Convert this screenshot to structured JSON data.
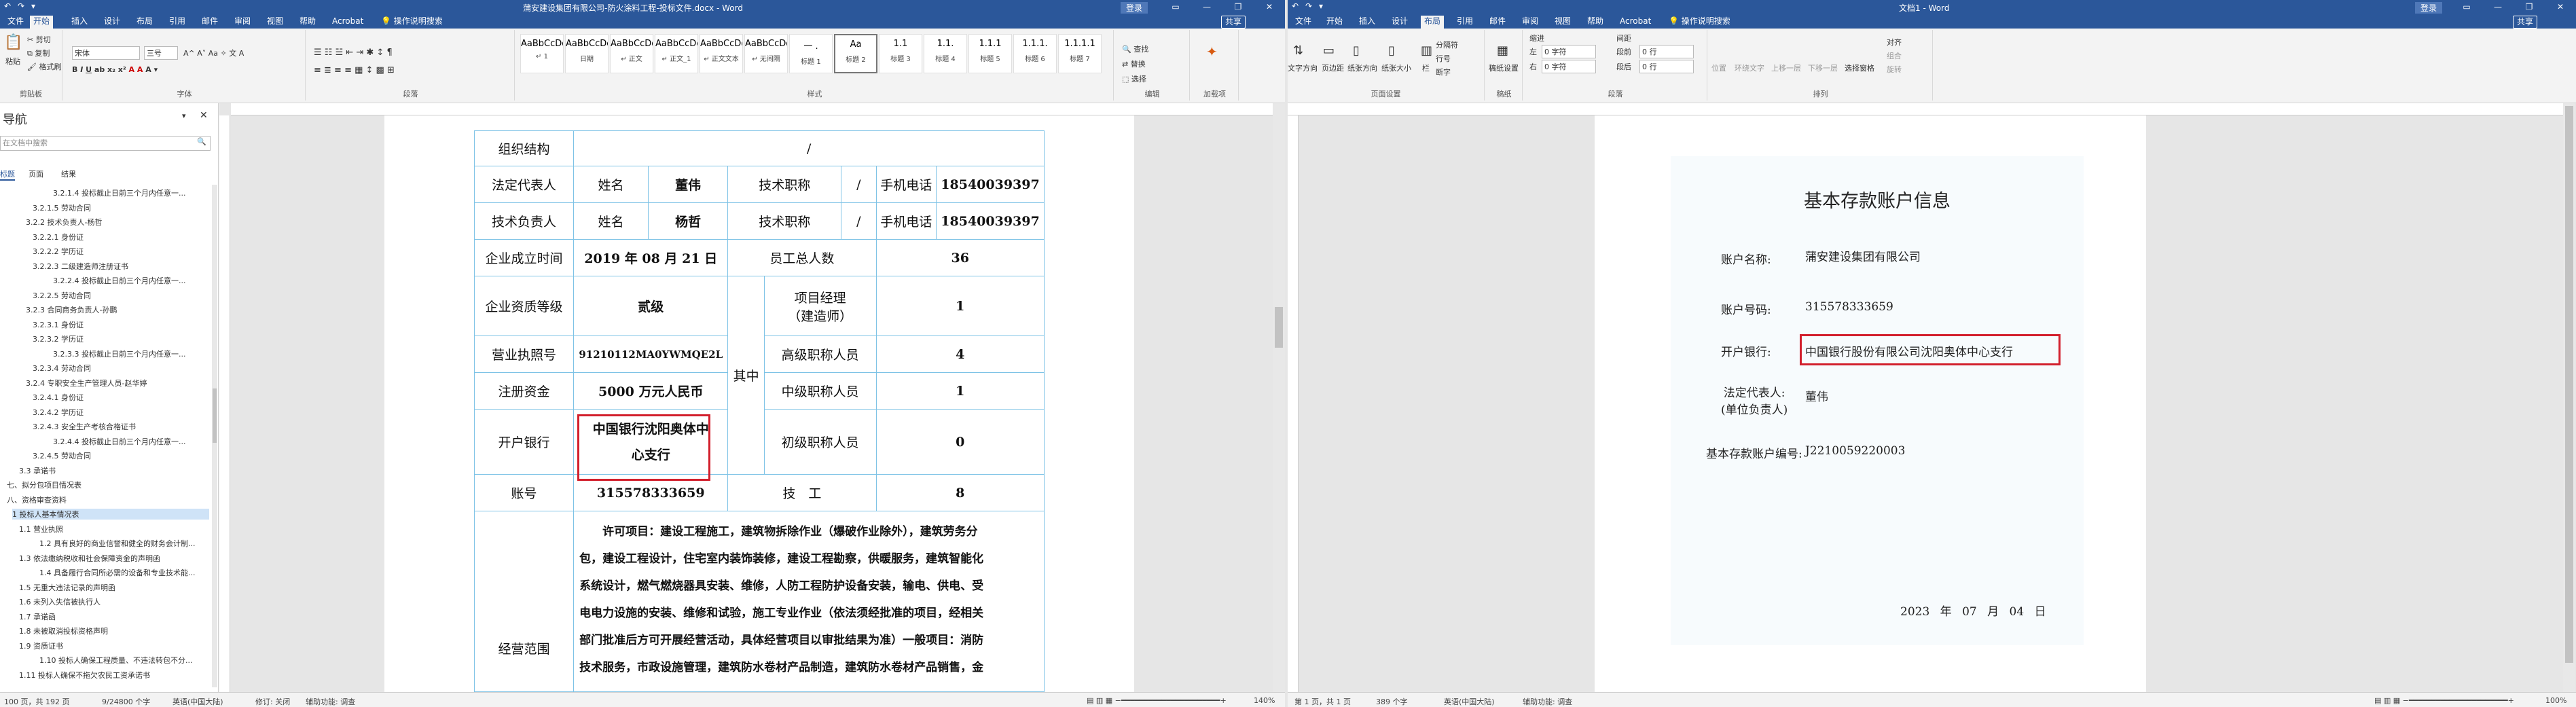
{
  "left": {
    "title": "蒲安建设集团有限公司-防火涂料工程-投标文件.docx - Word",
    "qat": [
      "↶",
      "↷",
      "▾"
    ],
    "account_btn": "登录",
    "share": "共享",
    "tabs": [
      "文件",
      "开始",
      "插入",
      "设计",
      "布局",
      "引用",
      "邮件",
      "审阅",
      "视图",
      "帮助",
      "Acrobat"
    ],
    "tell_me": "操作说明搜索",
    "ribbon": {
      "clipboard": {
        "paste": "粘贴",
        "cut": "剪切",
        "copy": "复制",
        "painter": "格式刷",
        "label": "剪贴板"
      },
      "font": {
        "name": "宋体",
        "size": "三号",
        "label": "字体"
      },
      "paragraph": {
        "label": "段落"
      },
      "styles": {
        "label": "样式",
        "items": [
          {
            "preview": "AaBbCcDd",
            "name": "↵ 1"
          },
          {
            "preview": "AaBbCcDc",
            "name": "日期"
          },
          {
            "preview": "AaBbCcDd",
            "name": "↵ 正文"
          },
          {
            "preview": "AaBbCcDc",
            "name": "↵ 正文_1"
          },
          {
            "preview": "AaBbCcDd",
            "name": "↵ 正文文本"
          },
          {
            "preview": "AaBbCcDd",
            "name": "↵ 无间隔"
          },
          {
            "preview": "一 .",
            "name": "标题 1"
          },
          {
            "preview": "Aa",
            "name": "标题 2"
          },
          {
            "preview": "1.1",
            "name": "标题 3"
          },
          {
            "preview": "1.1.",
            "name": "标题 4"
          },
          {
            "preview": "1.1.1",
            "name": "标题 5"
          },
          {
            "preview": "1.1.1.",
            "name": "标题 6"
          },
          {
            "preview": "1.1.1.1",
            "name": "标题 7"
          }
        ]
      },
      "editing": {
        "find": "查找",
        "replace": "替换",
        "select": "选择",
        "label": "编辑"
      },
      "addin": {
        "label": "加载项"
      }
    },
    "nav": {
      "title": "导航",
      "search_placeholder": "在文档中搜索",
      "tabs": [
        "标题",
        "页面",
        "结果"
      ],
      "items": [
        "3.2.1.4 投标截止日前三个月内任意一...",
        "3.2.1.5 劳动合同",
        "3.2.2 技术负责人-杨哲",
        "3.2.2.1 身份证",
        "3.2.2.2 学历证",
        "3.2.2.3 二级建造师注册证书",
        "3.2.2.4 投标截止日前三个月内任意一...",
        "3.2.2.5 劳动合同",
        "3.2.3 合同商务负责人-孙鹏",
        "3.2.3.1 身份证",
        "3.2.3.2 学历证",
        "3.2.3.3 投标截止日前三个月内任意一...",
        "3.2.3.4 劳动合同",
        "3.2.4 专职安全生产管理人员-赵华婷",
        "3.2.4.1 身份证",
        "3.2.4.2 学历证",
        "3.2.4.3 安全生产考核合格证书",
        "3.2.4.4 投标截止日前三个月内任意一...",
        "3.2.4.5 劳动合同",
        "3.3 承诺书",
        "七、拟分包项目情况表",
        "八、资格审查资料",
        "1 投标人基本情况表",
        "1.1 营业执照",
        "1.2 具有良好的商业信誉和健全的财务会计制...",
        "1.3 依法缴纳税收和社会保障资金的声明函",
        "1.4 具备履行合同所必需的设备和专业技术能...",
        "1.5 无重大违法记录的声明函",
        "1.6 未列入失信被执行人",
        "1.7 承诺函",
        "1.8 未被取消投标资格声明",
        "1.9 资质证书",
        "1.10 投标人确保工程质量、不违法转包不分...",
        "1.11 投标人确保不拖欠农民工资承诺书"
      ]
    },
    "table": {
      "org_label": "组织结构",
      "org_value": "/",
      "legal_rep_label": "法定代表人",
      "name_label": "姓名",
      "legal_rep_name": "董伟",
      "tech_title_label": "技术职称",
      "slash": "/",
      "phone_label": "手机电话",
      "legal_rep_phone": "18540039397",
      "tech_lead_label": "技术负责人",
      "tech_lead_name": "杨哲",
      "tech_lead_phone": "18540039397",
      "founded_label": "企业成立时间",
      "founded_value": "2019 年 08 月 21 日",
      "staff_label": "员工总人数",
      "staff_value": "36",
      "qual_label": "企业资质等级",
      "qual_value": "贰级",
      "among_label": "其中",
      "pm_label": "项目经理",
      "pm_label2": "（建造师）",
      "pm_value": "1",
      "license_label": "营业执照号",
      "license_value": "91210112MA0YWMQE2L",
      "senior_label": "高级职称人员",
      "senior_value": "4",
      "capital_label": "注册资金",
      "capital_value": "5000 万元人民币",
      "mid_label": "中级职称人员",
      "mid_value": "1",
      "bank_label": "开户银行",
      "bank_value_1": "中国银行沈阳奥体中",
      "bank_value_2": "心支行",
      "junior_label": "初级职称人员",
      "junior_value": "0",
      "account_label": "账号",
      "account_value": "315578333659",
      "tech_label": "技　工",
      "tech_value": "8",
      "scope_label": "经营范围",
      "scope_lines": [
        "许可项目：建设工程施工，建筑物拆除作业（爆破作业除外），建筑劳务分",
        "包，建设工程设计，住宅室内装饰装修，建设工程勘察，供暖服务，建筑智能化",
        "系统设计，燃气燃烧器具安装、维修，人防工程防护设备安装，输电、供电、受",
        "电电力设施的安装、维修和试验，施工专业作业（依法须经批准的项目，经相关",
        "部门批准后方可开展经营活动，具体经营项目以审批结果为准）一般项目：消防",
        "技术服务，市政设施管理，建筑防水卷材产品制造，建筑防水卷材产品销售，金"
      ]
    },
    "status": {
      "page": "100 页，共 192 页",
      "words": "9/24800 个字",
      "lang": "英语(中国大陆)",
      "track": "修订: 关闭",
      "access": "辅助功能: 调查",
      "zoom": "140%"
    }
  },
  "right": {
    "title": "文档1 - Word",
    "qat": [
      "↶",
      "↷",
      "▾"
    ],
    "account_btn": "登录",
    "share": "共享",
    "tabs": [
      "文件",
      "开始",
      "插入",
      "设计",
      "布局",
      "引用",
      "邮件",
      "审阅",
      "视图",
      "帮助",
      "Acrobat"
    ],
    "tell_me": "操作说明搜索",
    "ribbon": {
      "page_setup": {
        "items": [
          "文字方向",
          "页边距",
          "纸张方向",
          "纸张大小",
          "栏"
        ],
        "breaks": "分隔符",
        "line_numbers": "行号",
        "hyphen": "断字",
        "label": "页面设置"
      },
      "manuscript": {
        "name": "稿纸设置",
        "label": "稿纸"
      },
      "paragraph": {
        "indent": "缩进",
        "spacing": "间距",
        "left": "左",
        "right": "右",
        "before": "段前",
        "after": "段后",
        "left_val": "0 字符",
        "right_val": "0 字符",
        "before_val": "0 行",
        "after_val": "0 行",
        "label": "段落"
      },
      "arrange": {
        "items": [
          "位置",
          "环绕文字",
          "上移一层",
          "下移一层",
          "选择窗格"
        ],
        "align": "对齐",
        "group": "组合",
        "rotate": "旋转",
        "label": "排列"
      }
    },
    "cert": {
      "title": "基本存款账户信息",
      "rows": [
        {
          "label": "账户名称:",
          "value": "蒲安建设集团有限公司"
        },
        {
          "label": "账户号码:",
          "value": "315578333659"
        },
        {
          "label": "开户银行:",
          "value": "中国银行股份有限公司沈阳奥体中心支行"
        },
        {
          "label": "法定代表人:",
          "label2": "(单位负责人)",
          "value": "董伟"
        },
        {
          "label": "基本存款账户编号:",
          "value": "J2210059220003"
        }
      ],
      "date_year": "2023",
      "date_y": "年",
      "date_month": "07",
      "date_m": "月",
      "date_day": "04",
      "date_d": "日"
    },
    "status": {
      "page": "第 1 页，共 1 页",
      "words": "389 个字",
      "lang": "英语(中国大陆)",
      "access": "辅助功能: 调查",
      "zoom": "100%"
    }
  },
  "colors": {
    "word_blue": "#2b579a",
    "highlight_red": "#d21f2c",
    "table_border": "#7ec3e6"
  }
}
